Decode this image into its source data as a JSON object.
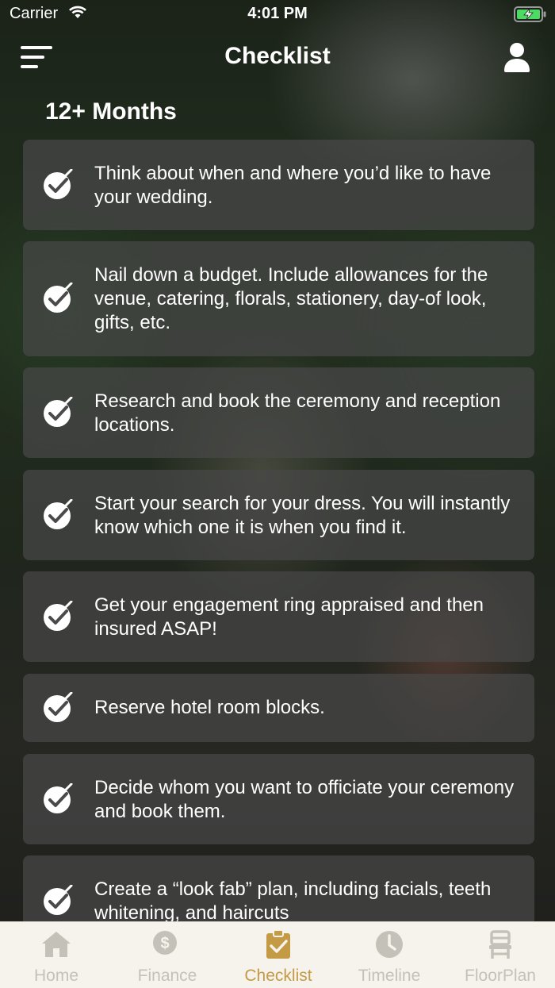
{
  "status_bar": {
    "carrier": "Carrier",
    "time": "4:01 PM"
  },
  "nav": {
    "title": "Checklist",
    "menu_icon": "hamburger-menu-icon",
    "profile_icon": "user-icon"
  },
  "section": {
    "title": "12+ Months"
  },
  "checklist": [
    {
      "text": "Think about when and where you’d like to have your wedding.",
      "checked": true
    },
    {
      "text": "Nail down a budget. Include allowances for the venue, catering, florals, stationery, day-of look, gifts, etc.",
      "checked": true
    },
    {
      "text": "Research and book the ceremony and reception locations.",
      "checked": true
    },
    {
      "text": "Start your search for your dress. You will instantly know which one it is when you find it.",
      "checked": true
    },
    {
      "text": "Get your engagement ring appraised and then insured ASAP!",
      "checked": true
    },
    {
      "text": "Reserve hotel room blocks.",
      "checked": true
    },
    {
      "text": "Decide whom you want to officiate your ceremony and book them.",
      "checked": true
    },
    {
      "text": "Create a “look fab” plan, including facials, teeth whitening, and haircuts",
      "checked": true
    }
  ],
  "tabs": [
    {
      "label": "Home",
      "icon": "home-icon",
      "active": false
    },
    {
      "label": "Finance",
      "icon": "dollar-coins-icon",
      "active": false
    },
    {
      "label": "Checklist",
      "icon": "clipboard-check-icon",
      "active": true
    },
    {
      "label": "Timeline",
      "icon": "clock-icon",
      "active": false
    },
    {
      "label": "FloorPlan",
      "icon": "chair-icon",
      "active": false
    }
  ],
  "colors": {
    "accent": "#c49a45",
    "tab_inactive": "#c4c1b9",
    "tab_bar_bg": "#f6f3ec",
    "card_bg": "#484848"
  }
}
